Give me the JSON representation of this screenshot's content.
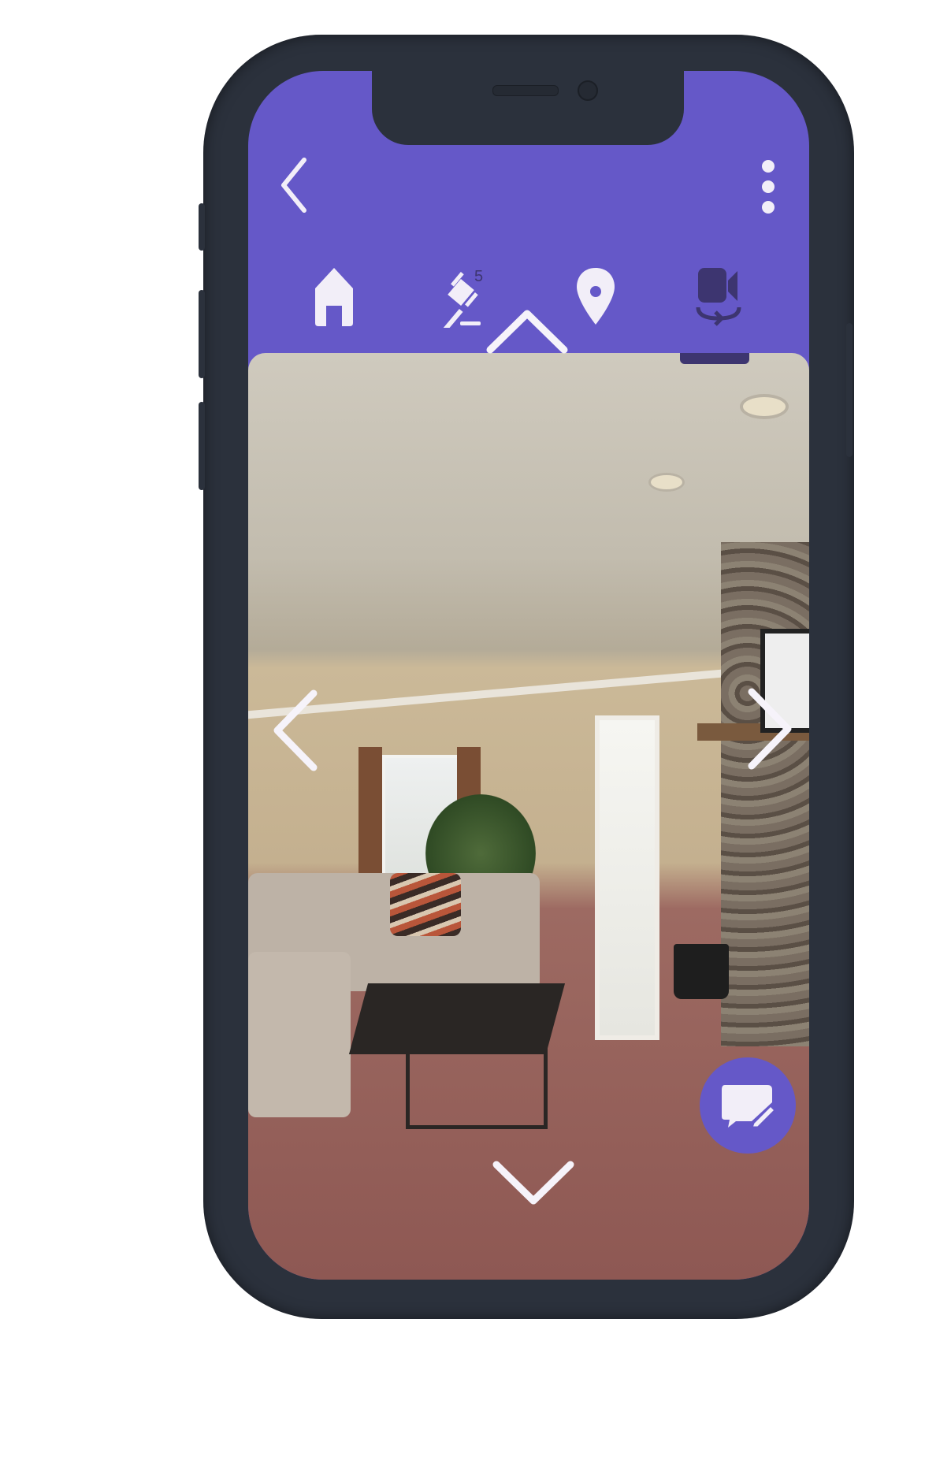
{
  "app": {
    "accent_color": "#6558c8",
    "frame_color": "#2b313c"
  },
  "header": {
    "back_icon": "chevron-left-icon",
    "menu_icon": "more-vertical-icon",
    "tabs": [
      {
        "name": "home",
        "icon": "home-icon"
      },
      {
        "name": "auction",
        "icon": "gavel-icon",
        "badge": "5"
      },
      {
        "name": "location",
        "icon": "map-pin-icon"
      },
      {
        "name": "virtual-tour",
        "icon": "360-video-icon",
        "active": true
      }
    ]
  },
  "viewer": {
    "nav": [
      "arrow-up-icon",
      "arrow-left-icon",
      "arrow-right-icon",
      "arrow-down-icon"
    ],
    "fab_icon": "chat-edit-icon"
  }
}
